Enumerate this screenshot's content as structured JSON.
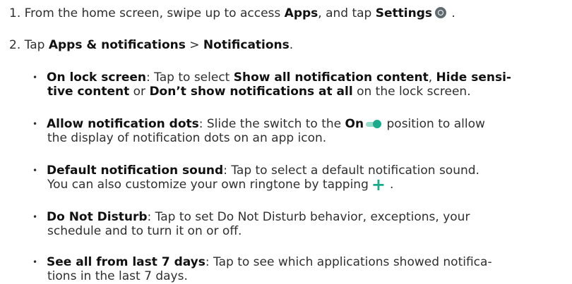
{
  "steps": [
    {
      "num": "1.",
      "t1": "From the home screen, swipe up to access ",
      "b1": "Apps",
      "t2": ", and tap ",
      "b2": "Settings",
      "t3": " ."
    },
    {
      "num": "2.",
      "t1": "Tap ",
      "b1": "Apps & notifications",
      "t2": " > ",
      "b2": "Notifications",
      "t3": "."
    }
  ],
  "bullet_char": "•",
  "items": [
    {
      "b1": "On lock screen",
      "t1": ": Tap to select ",
      "b2": "Show all notification content",
      "t2": ", ",
      "b3": "Hide sensi-",
      "b4": "tive content",
      "t3": " or ",
      "b5": "Don’t show notifications at all",
      "t4": " on the lock screen."
    },
    {
      "b1": "Allow notification dots",
      "t1": ": Slide the switch to the ",
      "b2": "On",
      "t2": " position to allow",
      "l2": "the display of notification dots on an app icon."
    },
    {
      "b1": "Default notification sound",
      "t1": ": Tap to select a default notification sound.",
      "l2": "You can also customize your own ringtone by tapping",
      "plus": "+",
      "t2": "."
    },
    {
      "b1": "Do Not Disturb",
      "t1": ": Tap to set Do Not Disturb behavior, exceptions, your",
      "l2": "schedule and to turn it on or off."
    },
    {
      "b1": "See all from last 7 days",
      "t1": ": Tap to see which applications showed notifica-",
      "l2": "tions in the last 7 days."
    }
  ],
  "icons": {
    "settings": "settings-gear-icon",
    "switch": "toggle-switch-on-icon",
    "plus": "plus-icon"
  },
  "colors": {
    "accent": "#1aab8a",
    "accent_light": "#8fdcc8",
    "icon_gray": "#5f6b70"
  }
}
